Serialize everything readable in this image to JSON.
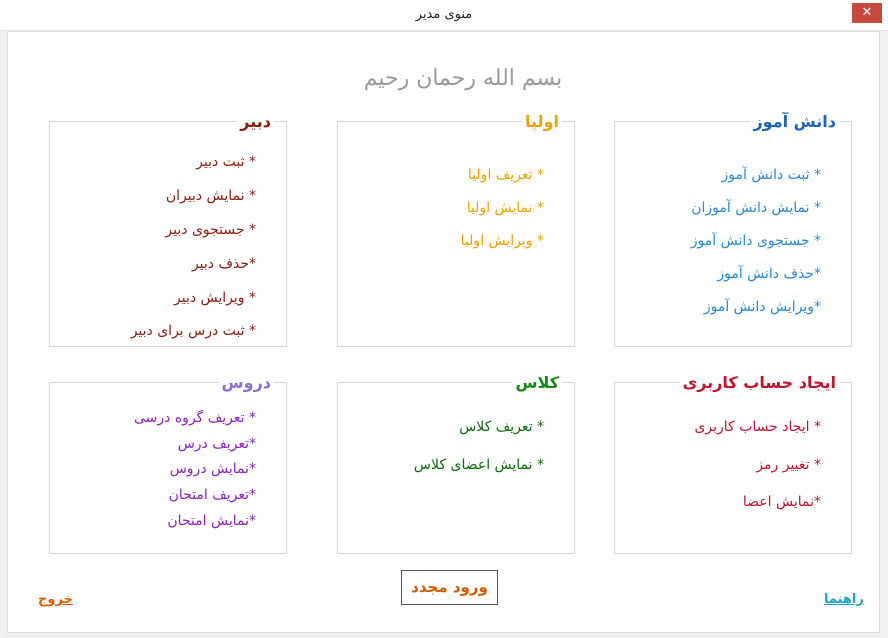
{
  "window": {
    "title": "منوی مدیر",
    "close_glyph": "✕"
  },
  "bismillah": "بسم الله رحمان رحیم",
  "groups": {
    "student": {
      "title": "دانش آموز",
      "items": [
        "* ثبت دانش آموز",
        "* نمایش دانش آموزان",
        "* جستجوی دانش آموز",
        "*حذف دانش آموز",
        "*ویرایش دانش آموز"
      ]
    },
    "parents": {
      "title": "اولیا",
      "items": [
        "* تعریف اولیا",
        "* نمایش اولیا",
        "* ویرایش اولیا"
      ]
    },
    "teacher": {
      "title": "دبیر",
      "items": [
        "* ثبت دبیر",
        "* نمایش دبیران",
        "* جستجوی دبیر",
        "*حذف دبیر",
        "* ویرایش دبیر",
        "* ثبت درس برای دبیر"
      ]
    },
    "account": {
      "title": "ایجاد حساب کاربری",
      "items": [
        "* ایجاد حساب کاربری",
        "* تغییر رمز",
        "*نمایش اعضا"
      ]
    },
    "class": {
      "title": "کلاس",
      "items": [
        "* تعریف کلاس",
        "* نمایش اعضای کلاس"
      ]
    },
    "courses": {
      "title": "دروس",
      "items": [
        "* تعریف گروه درسی",
        "*تعریف درس",
        "*نمایش دروس",
        "*تعریف امتحان",
        "*نمایش امتحان"
      ]
    }
  },
  "footer": {
    "relogin": "ورود مجدد",
    "help": "راهنما",
    "exit": "خروج"
  },
  "colors": {
    "student": "#2a88d6",
    "parents": "#eda200",
    "teacher": "#8f1a0e",
    "account": "#c0142d",
    "class": "#0a6a0a",
    "courses": "#8a22c0"
  }
}
